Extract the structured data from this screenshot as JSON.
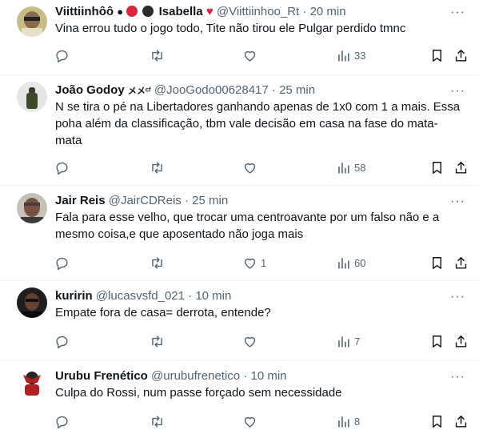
{
  "tweets": [
    {
      "name": "Viittiinhôô",
      "name_extra": "Isabella",
      "handle": "@Viittiinhoo_Rt",
      "time": "20 min",
      "text": "Vina errou tudo o jogo todo, Tite não tirou ele Pulgar perdido tmnc",
      "likes": "",
      "views": "33",
      "avatar_colors": [
        "#b8a86d",
        "#5a5a3a"
      ]
    },
    {
      "name": "João Godoy",
      "name_extra": "メメᶜᶠ",
      "handle": "@JooGodo00628417",
      "time": "25 min",
      "text": "N se tira o pé na Libertadores ganhando apenas de 1x0 com 1 a mais. Essa poha além da classificação, tbm vale decisão em casa na fase do mata-mata",
      "likes": "",
      "views": "58",
      "avatar_colors": [
        "#e8e8e8",
        "#3d4a2a"
      ]
    },
    {
      "name": "Jair Reis",
      "name_extra": "",
      "handle": "@JairCDReis",
      "time": "25 min",
      "text": "Fala para esse velho, que trocar uma centroavante por um falso não e a mesmo coisa,e que aposentado não joga mais",
      "likes": "1",
      "views": "60",
      "avatar_colors": [
        "#c7c2b8",
        "#6b4a3a"
      ]
    },
    {
      "name": "kuririn",
      "name_extra": "",
      "handle": "@lucasvsfd_021",
      "time": "10 min",
      "text": "Empate fora de casa= derrota, entende?",
      "likes": "",
      "views": "7",
      "avatar_colors": [
        "#2a2a2a",
        "#5a3a2a"
      ]
    },
    {
      "name": "Urubu Frenético",
      "name_extra": "",
      "handle": "@urubufrenetico",
      "time": "10 min",
      "text": "Culpa do Rossi, num passe forçado sem necessidade",
      "likes": "",
      "views": "8",
      "avatar_colors": [
        "#ffffff",
        "#b02020"
      ]
    }
  ],
  "separator": "·",
  "more_glyph": "···",
  "colors": {
    "muted": "#536471",
    "text": "#0f1419",
    "divider": "#eff3f4",
    "heart": "#d7263d"
  },
  "icons": [
    "reply-icon",
    "retweet-icon",
    "like-icon",
    "views-icon",
    "bookmark-icon",
    "share-icon"
  ]
}
